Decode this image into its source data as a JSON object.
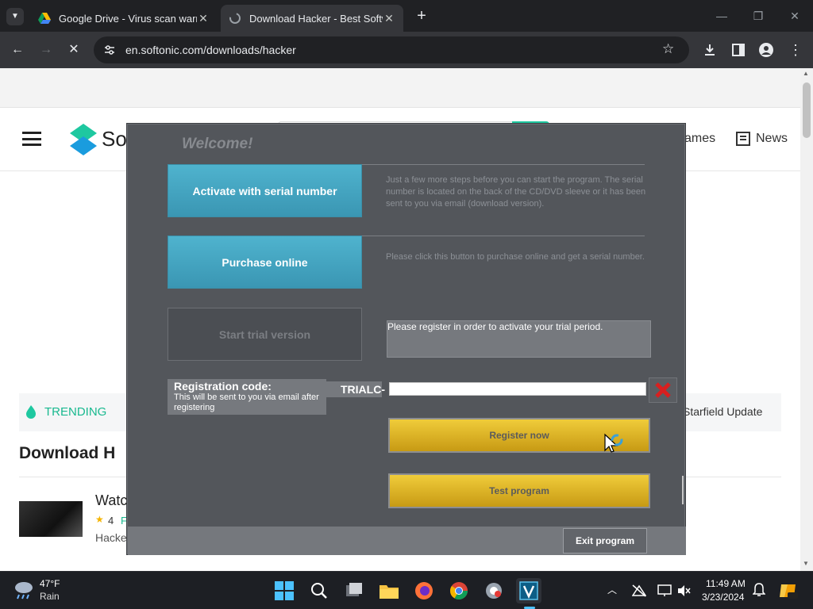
{
  "browser": {
    "tabs": [
      {
        "title": "Google Drive - Virus scan warnin",
        "close": "✕"
      },
      {
        "title": "Download Hacker - Best Softwa",
        "close": "✕"
      }
    ],
    "new_tab": "+",
    "url": "en.softonic.com/downloads/hacker"
  },
  "site": {
    "logo_text": "So",
    "nav": [
      "ames",
      "News"
    ],
    "trending_label": "TRENDING",
    "trending_item": "Starfield Update",
    "section_title": "Download H",
    "item": {
      "title": "Watc",
      "rating": "4",
      "rating_suffix": "F",
      "subtitle": "Hacke"
    }
  },
  "dialog": {
    "title": "Welcome!",
    "activate_label": "Activate with serial number",
    "activate_desc": "Just a few more steps before you can start the program. The serial number is located on the back of the CD/DVD sleeve or it has been sent to you via email (download version).",
    "purchase_label": "Purchase online",
    "purchase_desc": "Please click this button to purchase online and get a serial number.",
    "trial_label": "Start trial version",
    "trial_msg": "Please register in order to activate your trial period.",
    "reg_title": "Registration code:",
    "reg_sub": "This will be sent to you via email after registering",
    "reg_prefix": "TRIALC-",
    "reg_value": "",
    "register_label": "Register now",
    "test_label": "Test program",
    "exit_label": "Exit program",
    "colors": {
      "accent_blue": "#43a7c4",
      "button_yellow": "#dfb322",
      "clear_red": "#d81f1f"
    }
  },
  "taskbar": {
    "weather_temp": "47°F",
    "weather_desc": "Rain",
    "time": "11:49 AM",
    "date": "3/23/2024"
  }
}
